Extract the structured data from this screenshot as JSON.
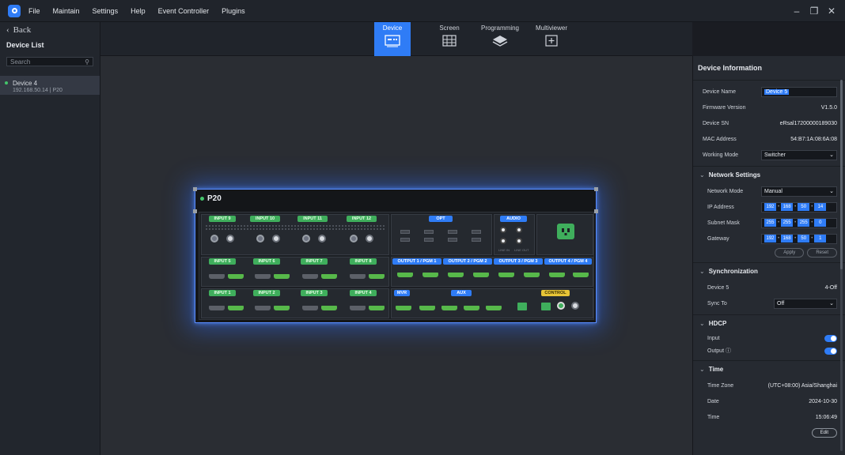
{
  "menubar": {
    "items": [
      "File",
      "Maintain",
      "Settings",
      "Help",
      "Event Controller",
      "Plugins"
    ]
  },
  "leftpanel": {
    "back_label": "Back",
    "title": "Device List",
    "search_placeholder": "Search",
    "devices": [
      {
        "name": "Device 4",
        "ip": "192.168.50.14 | P20"
      }
    ]
  },
  "tabs": [
    {
      "label": "Device"
    },
    {
      "label": "Screen"
    },
    {
      "label": "Programming"
    },
    {
      "label": "Multiviewer"
    }
  ],
  "device": {
    "name": "P20",
    "inputs_top": [
      "INPUT 9",
      "INPUT 10",
      "INPUT 11",
      "INPUT 12"
    ],
    "inputs_mid": [
      "INPUT 5",
      "INPUT 6",
      "INPUT 7",
      "INPUT 8"
    ],
    "inputs_bot": [
      "INPUT 1",
      "INPUT 2",
      "INPUT 3",
      "INPUT 4"
    ],
    "opt": "OPT",
    "audio": "AUDIO",
    "outputs": [
      "OUTPUT 1 / PGM 1",
      "OUTPUT 2 / PGM 2",
      "OUTPUT 3 / PGM 3",
      "OUTPUT 4 / PGM 4"
    ],
    "mvr": "MVR",
    "aux": "AUX",
    "control": "CONTROL",
    "audio_sub": [
      "LINE IN",
      "LINE OUT"
    ]
  },
  "rightpanel": {
    "title": "Device Information",
    "device_name_label": "Device Name",
    "device_name": "Device 5",
    "firmware_label": "Firmware Version",
    "firmware": "V1.5.0",
    "sn_label": "Device SN",
    "sn": "eRsal17200000189030",
    "mac_label": "MAC Address",
    "mac": "54:B7:1A:08:6A:08",
    "working_mode_label": "Working Mode",
    "working_mode": "Switcher",
    "network": {
      "title": "Network Settings",
      "mode_label": "Network Mode",
      "mode": "Manual",
      "ip_label": "IP Address",
      "ip": [
        "192",
        "168",
        "50",
        "14"
      ],
      "mask_label": "Subnet Mask",
      "mask": [
        "255",
        "255",
        "255",
        "0"
      ],
      "gw_label": "Gateway",
      "gw": [
        "192",
        "168",
        "50",
        "1"
      ],
      "apply": "Apply",
      "reset": "Reset"
    },
    "sync": {
      "title": "Synchronization",
      "device_label": "Device 5",
      "device_value": "4-Off",
      "sync_label": "Sync To",
      "sync_value": "Off"
    },
    "hdcp": {
      "title": "HDCP",
      "input_label": "Input",
      "output_label": "Output"
    },
    "time": {
      "title": "Time",
      "zone_label": "Time Zone",
      "zone": "(UTC+08:00) Asia/Shanghai",
      "date_label": "Date",
      "date": "2024-10-30",
      "time_label": "Time",
      "time": "15:06:49",
      "edit": "Edit"
    }
  },
  "colors": {
    "accent": "#2f7cf6",
    "green": "#3fae5c",
    "yellow": "#e7c437"
  }
}
